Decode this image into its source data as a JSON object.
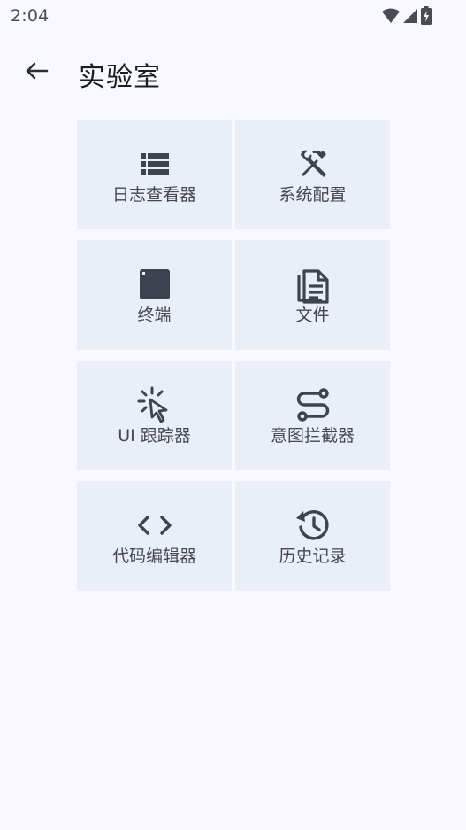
{
  "status_bar": {
    "time": "2:04"
  },
  "header": {
    "title": "实验室"
  },
  "colors": {
    "background": "#f7f9ff",
    "tile": "#e9eef7",
    "icon": "#3e4350"
  },
  "tiles": [
    {
      "label": "日志查看器",
      "icon": "list-icon"
    },
    {
      "label": "系统配置",
      "icon": "tools-icon"
    },
    {
      "label": "终端",
      "icon": "terminal-icon"
    },
    {
      "label": "文件",
      "icon": "file-icon"
    },
    {
      "label": "UI 跟踪器",
      "icon": "cursor-click-icon"
    },
    {
      "label": "意图拦截器",
      "icon": "route-icon"
    },
    {
      "label": "代码编辑器",
      "icon": "code-icon"
    },
    {
      "label": "历史记录",
      "icon": "history-icon"
    }
  ]
}
